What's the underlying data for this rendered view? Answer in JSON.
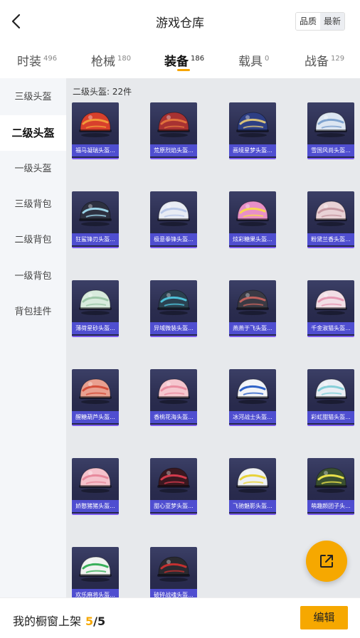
{
  "header": {
    "title": "游戏仓库",
    "back_icon": "chevron-left-icon",
    "sort_options": [
      "品质",
      "最新"
    ]
  },
  "tabs": [
    {
      "label": "时装",
      "count": "496"
    },
    {
      "label": "枪械",
      "count": "180"
    },
    {
      "label": "装备",
      "count": "186",
      "active": true
    },
    {
      "label": "载具",
      "count": "0"
    },
    {
      "label": "战备",
      "count": "129"
    }
  ],
  "sidebar": {
    "items": [
      "三级头盔",
      "二级头盔",
      "一级头盔",
      "三级背包",
      "二级背包",
      "一级背包",
      "背包挂件"
    ],
    "active_index": 1
  },
  "grid": {
    "heading": "二级头盔: 22件",
    "items": [
      {
        "label": "福马凝瑞头盔...",
        "color": "#d8402c",
        "accent": "#f29a3a"
      },
      {
        "label": "荒原烈焰头盔...",
        "color": "#a83232",
        "accent": "#e0723c"
      },
      {
        "label": "画境星梦头盔...",
        "color": "#2e3f84",
        "accent": "#d9c27a"
      },
      {
        "label": "雪国风尚头盔...",
        "color": "#dce6f2",
        "accent": "#7fa3cf"
      },
      {
        "label": "狂鲨锋刃头盔...",
        "color": "#2d3140",
        "accent": "#9ad3e6"
      },
      {
        "label": "极意拳锋头盔...",
        "color": "#e8ecf4",
        "accent": "#b9c8e8"
      },
      {
        "label": "炫彩糖果头盔...",
        "color": "#e890c8",
        "accent": "#f7d84f"
      },
      {
        "label": "粉黛兰香头盔...",
        "color": "#e9d2d6",
        "accent": "#c79aa3"
      },
      {
        "label": "薄荷星砂头盔...",
        "color": "#d8ebdd",
        "accent": "#9ec8a9"
      },
      {
        "label": "异域微装头盔...",
        "color": "#2b4150",
        "accent": "#4ec0d8"
      },
      {
        "label": "燕燕于飞头盔...",
        "color": "#3a3a44",
        "accent": "#c0615d"
      },
      {
        "label": "千金淑猫头盔...",
        "color": "#f2dfe6",
        "accent": "#e69ab4"
      },
      {
        "label": "醒糖葫芦头盔...",
        "color": "#e9a090",
        "accent": "#d5503c"
      },
      {
        "label": "香桃花海头盔...",
        "color": "#f5c7cf",
        "accent": "#ea8fa2"
      },
      {
        "label": "冰河战士头盔...",
        "color": "#f2f4f8",
        "accent": "#2f63c8"
      },
      {
        "label": "彩虹甜猫头盔...",
        "color": "#eaeef4",
        "accent": "#86cfd8"
      },
      {
        "label": "娇憨猪猪头盔...",
        "color": "#f5c2cc",
        "accent": "#e7899c"
      },
      {
        "label": "甜心亚梦头盔...",
        "color": "#3a1820",
        "accent": "#d23a4c"
      },
      {
        "label": "飞驰魅影头盔...",
        "color": "#eef0f4",
        "accent": "#e8d23a"
      },
      {
        "label": "萌趣颜团子头...",
        "color": "#3a5030",
        "accent": "#e8e04a"
      },
      {
        "label": "欢乐麻将头盔...",
        "color": "#f0f2f0",
        "accent": "#3ab05a"
      },
      {
        "label": "破碎战魂头盔...",
        "color": "#2a2a30",
        "accent": "#c23030"
      }
    ]
  },
  "share_icon": "share-external-icon",
  "bottom": {
    "shelf_label": "我的橱窗上架",
    "shelf_current": "5",
    "shelf_total": "/5",
    "edit_label": "编辑"
  }
}
